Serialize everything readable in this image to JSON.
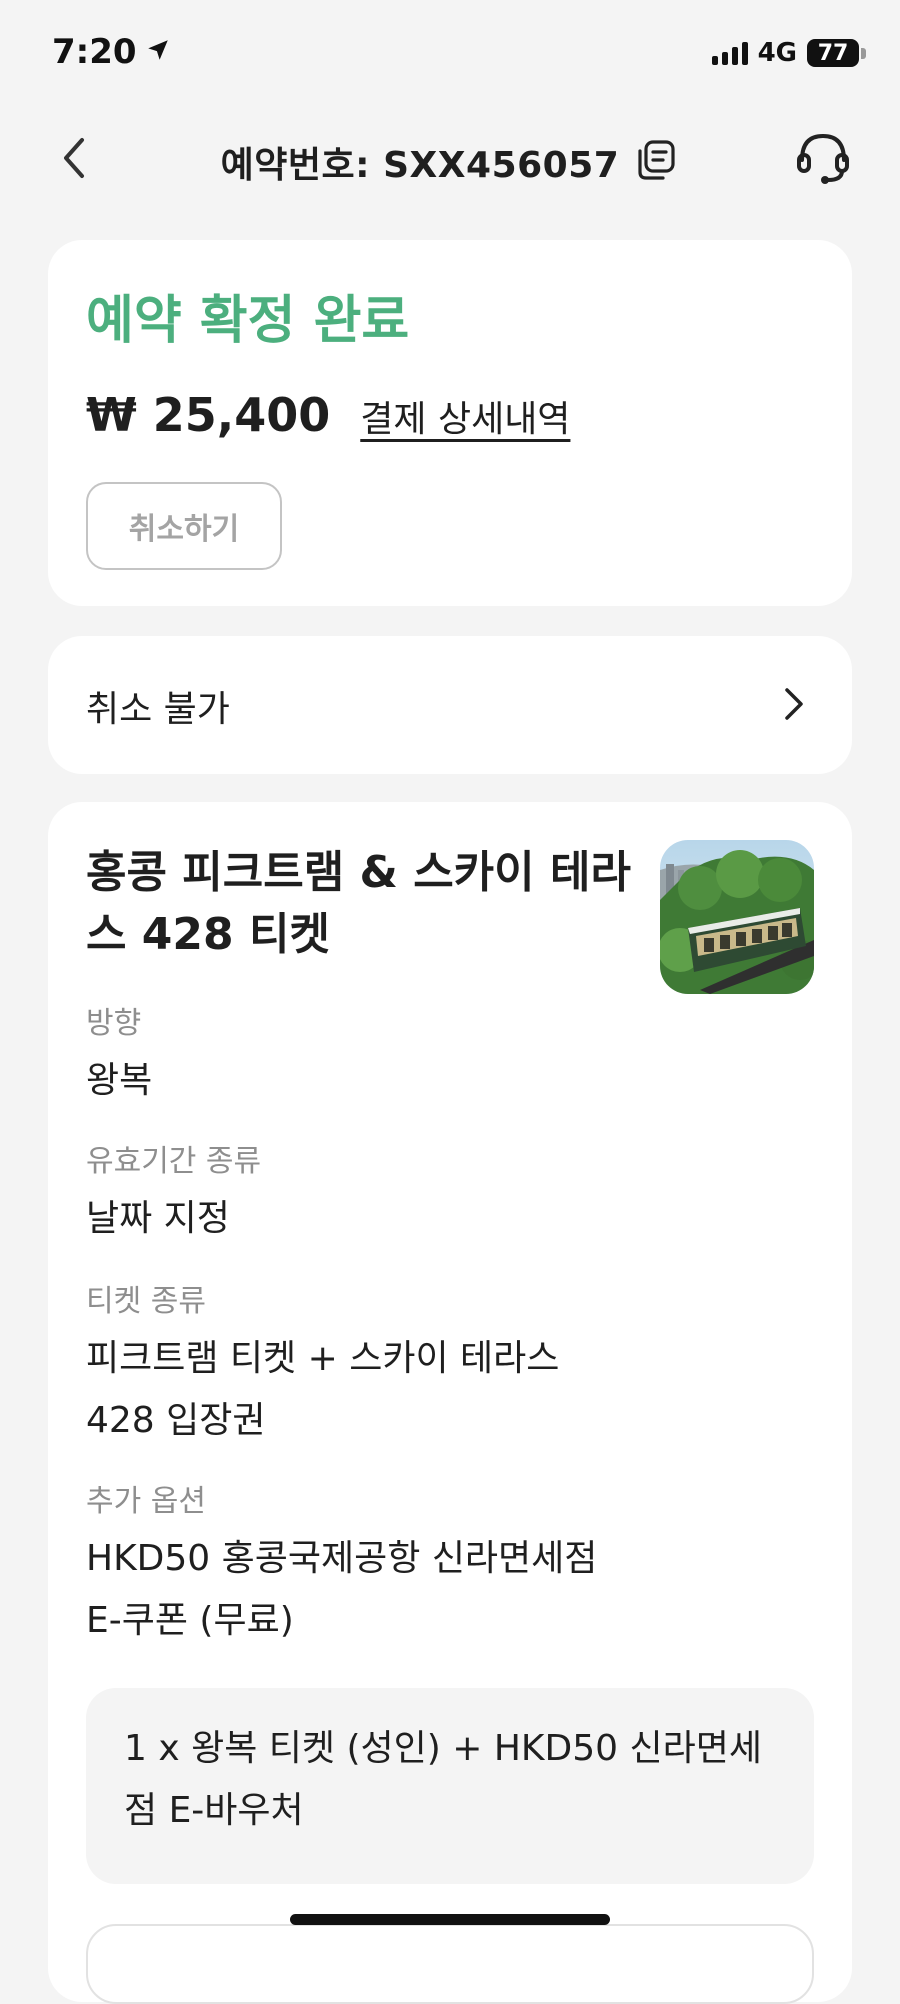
{
  "status_bar": {
    "time": "7:20",
    "network": "4G",
    "battery": "77",
    "battery_fraction": 0.77
  },
  "header": {
    "title": "예약번호: SXX456057"
  },
  "booking": {
    "status": "예약 확정 완료",
    "price": "₩ 25,400",
    "payment_details_link": "결제 상세내역",
    "cancel_button": "취소하기",
    "accent_color": "#4caf7e"
  },
  "policy": {
    "label": "취소 불가"
  },
  "product": {
    "title": "홍콩 피크트램 & 스카이 테라스 428 티켓",
    "details": [
      {
        "label": "방향",
        "value": "왕복"
      },
      {
        "label": "유효기간 종류",
        "value": "날짜 지정"
      },
      {
        "label": "티켓 종류",
        "value": "피크트램 티켓 + 스카이 테라스 428 입장권"
      },
      {
        "label": "추가 옵션",
        "value": "HKD50 홍콩국제공항 신라면세점 E-쿠폰 (무료)"
      }
    ],
    "summary": "1 x 왕복 티켓 (성인) + HKD50 신라면세점 E-바우처"
  },
  "icons": {
    "location": "location-arrow-icon",
    "back": "chevron-left-icon",
    "copy": "copy-icon",
    "support": "headset-icon",
    "chevron": "chevron-right-icon"
  }
}
